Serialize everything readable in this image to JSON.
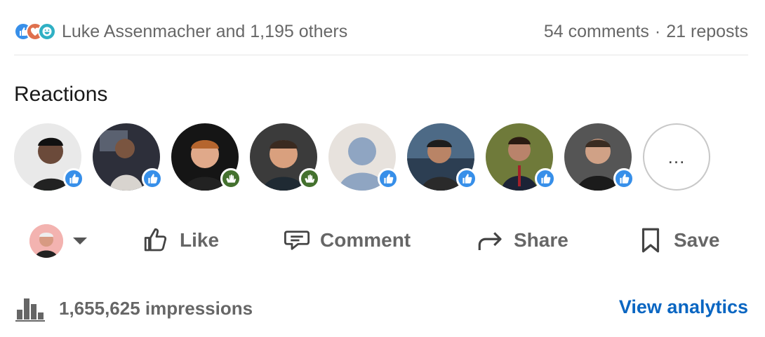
{
  "summary": {
    "reactors_text": "Luke Assenmacher and 1,195 others",
    "comments_text": "54 comments",
    "separator": "·",
    "reposts_text": "21 reposts",
    "reaction_icons": [
      "like-icon",
      "love-icon",
      "funny-icon"
    ]
  },
  "reactions": {
    "title": "Reactions",
    "more_label": "...",
    "people": [
      {
        "badge": "like"
      },
      {
        "badge": "like"
      },
      {
        "badge": "praise"
      },
      {
        "badge": "praise"
      },
      {
        "badge": "like"
      },
      {
        "badge": "like"
      },
      {
        "badge": "like"
      },
      {
        "badge": "like"
      }
    ]
  },
  "actions": {
    "like_label": "Like",
    "comment_label": "Comment",
    "share_label": "Share",
    "save_label": "Save"
  },
  "footer": {
    "impressions_text": "1,655,625 impressions",
    "analytics_label": "View analytics"
  },
  "colors": {
    "like_blue": "#378fe9",
    "praise_green": "#44712e",
    "link_blue": "#0a66c2"
  }
}
